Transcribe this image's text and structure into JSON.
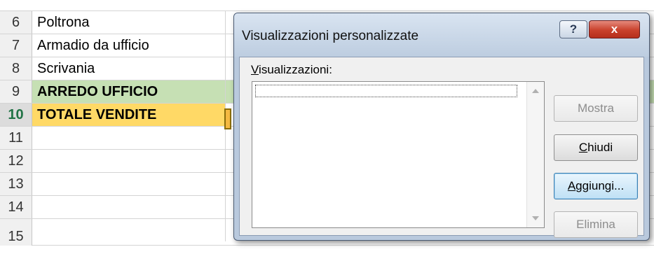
{
  "sheet": {
    "rows": [
      {
        "num": "6",
        "text": "Poltrona"
      },
      {
        "num": "7",
        "text": "Armadio da ufficio"
      },
      {
        "num": "8",
        "text": "Scrivania"
      },
      {
        "num": "9",
        "text": "ARREDO UFFICIO"
      },
      {
        "num": "10",
        "text": "TOTALE VENDITE"
      },
      {
        "num": "11",
        "text": ""
      },
      {
        "num": "12",
        "text": ""
      },
      {
        "num": "13",
        "text": ""
      },
      {
        "num": "14",
        "text": ""
      },
      {
        "num": "15",
        "text": ""
      }
    ],
    "colors": {
      "subtotal_row": "#c6e0b4",
      "total_row": "#ffd966",
      "active_row_number": "#217346"
    }
  },
  "dialog": {
    "title": "Visualizzazioni personalizzate",
    "help_label": "?",
    "close_label": "x",
    "list_label_accel": "V",
    "list_label_rest": "isualizzazioni:",
    "buttons": {
      "show": "Mostra",
      "close_accel": "C",
      "close_rest": "hiudi",
      "add_accel": "A",
      "add_rest": "ggiungi...",
      "delete": "Elimina"
    }
  }
}
